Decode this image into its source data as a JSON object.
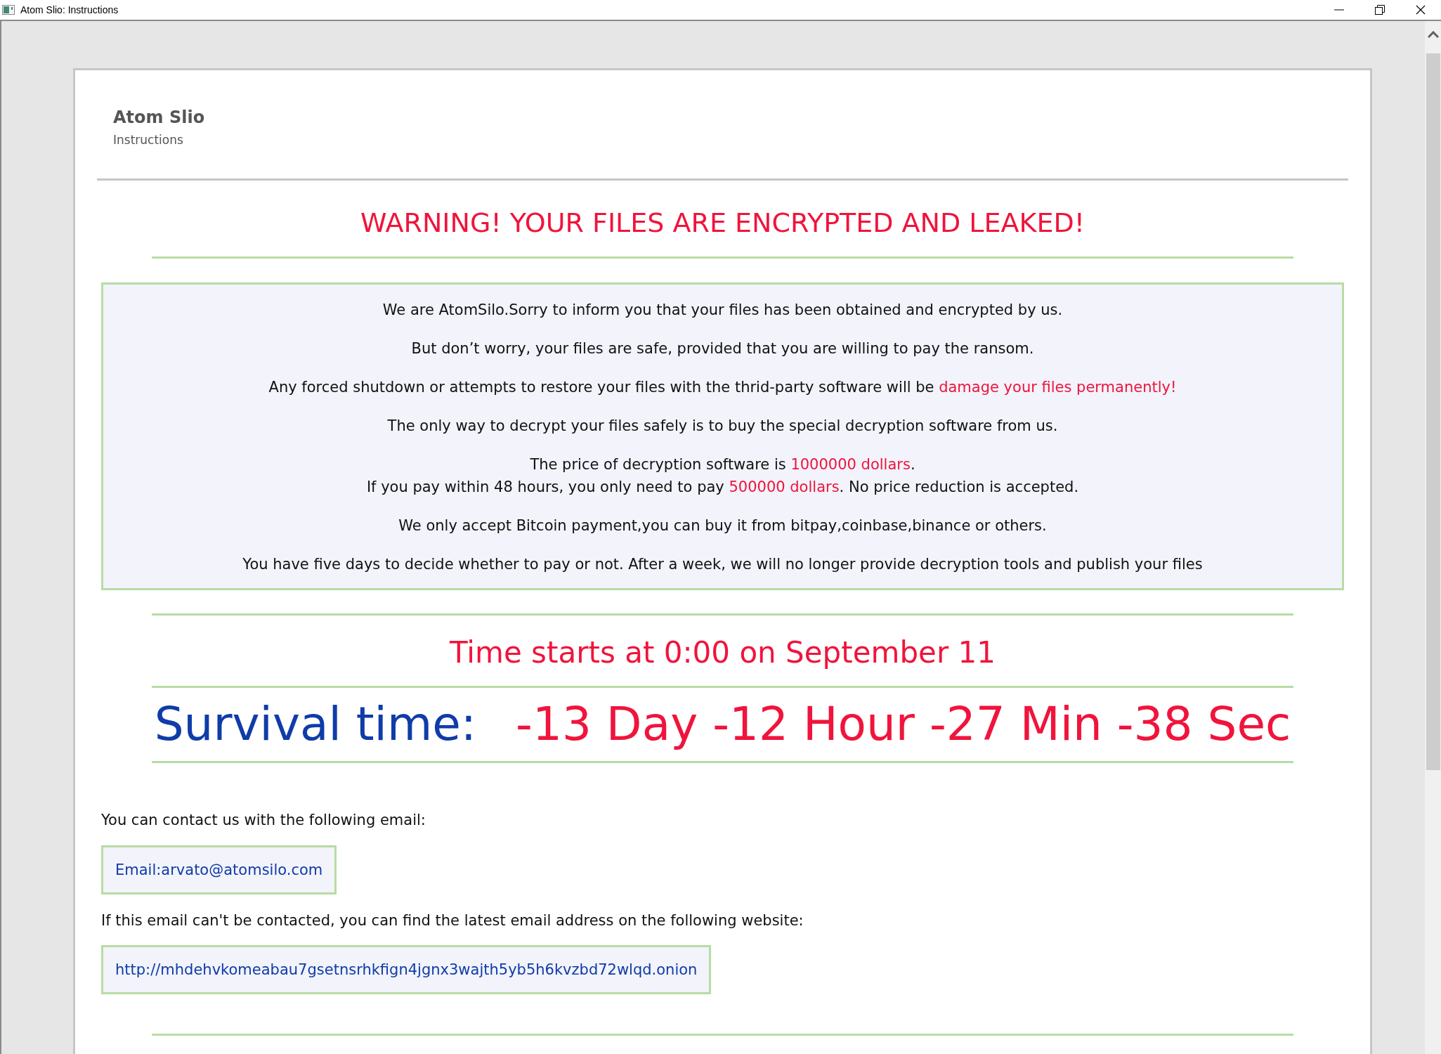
{
  "window": {
    "title": "Atom Slio: Instructions"
  },
  "header": {
    "title": "Atom Slio",
    "subtitle": "Instructions"
  },
  "warning": "WARNING! YOUR FILES ARE ENCRYPTED AND LEAKED!",
  "notice": [
    [
      [
        {
          "text": "We are AtomSilo.Sorry to inform you that your files has been obtained and encrypted by us.",
          "highlight": false
        }
      ]
    ],
    [
      [
        {
          "text": "But don’t worry, your files are safe, provided that you are willing to pay the ransom.",
          "highlight": false
        }
      ]
    ],
    [
      [
        {
          "text": "Any forced shutdown or attempts to restore your files with the thrid-party software will be ",
          "highlight": false
        },
        {
          "text": "damage your files permanently!",
          "highlight": true
        }
      ]
    ],
    [
      [
        {
          "text": "The only way to decrypt your files safely is to buy the special decryption software from us.",
          "highlight": false
        }
      ]
    ],
    [
      [
        {
          "text": "The price of decryption software is ",
          "highlight": false
        },
        {
          "text": "1000000 dollars",
          "highlight": true
        },
        {
          "text": ".",
          "highlight": false
        }
      ],
      [
        {
          "text": "If you pay within 48 hours, you only need to pay ",
          "highlight": false
        },
        {
          "text": "500000 dollars",
          "highlight": true
        },
        {
          "text": ". No price reduction is accepted.",
          "highlight": false
        }
      ]
    ],
    [
      [
        {
          "text": "We only accept Bitcoin payment,you can buy it from bitpay,coinbase,binance or others.",
          "highlight": false
        }
      ]
    ],
    [
      [
        {
          "text": "You have five days to decide whether to pay or not. After a week, we will no longer provide decryption tools and publish your files",
          "highlight": false
        }
      ]
    ]
  ],
  "time_start": "Time starts at 0:00 on September 11",
  "survival": {
    "label": "Survival time:",
    "countdown": "-13 Day -12 Hour -27 Min -38 Sec"
  },
  "contact": {
    "intro": "You can contact us with the following email:",
    "email": "Email:arvato@atomsilo.com",
    "fallback": "If this email can't be contacted, you can find the latest email address on the following website:",
    "website": "http://mhdehvkomeabau7gsetnsrhkfign4jgnx3wajth5yb5h6kvzbd72wlqd.onion"
  }
}
